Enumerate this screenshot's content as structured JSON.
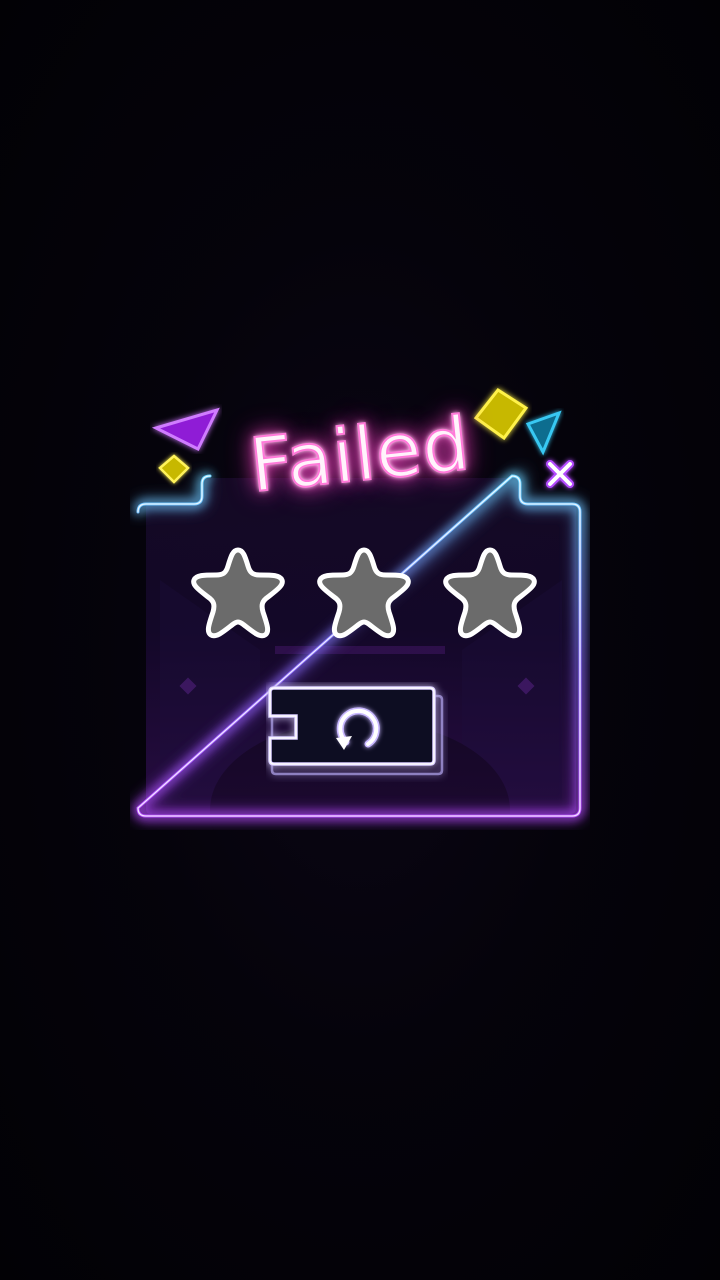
{
  "dialog": {
    "title": "Failed",
    "close_label": "x",
    "stars_earned": 0,
    "stars_total": 3
  },
  "colors": {
    "background": "#030208",
    "frame_cyan": "#58c8ff",
    "frame_purple": "#b64cff",
    "title_glow": "#ff7ad9",
    "star_fill": "#6b6b6b",
    "star_outline": "#ffffff",
    "retry_outline": "#c9b8ff",
    "deco_yellow": "#f0e020",
    "deco_purple": "#b336ff",
    "deco_cyan": "#2fb7e8"
  },
  "icons": {
    "close": "close-icon",
    "retry": "retry-icon",
    "star": "star-icon"
  }
}
